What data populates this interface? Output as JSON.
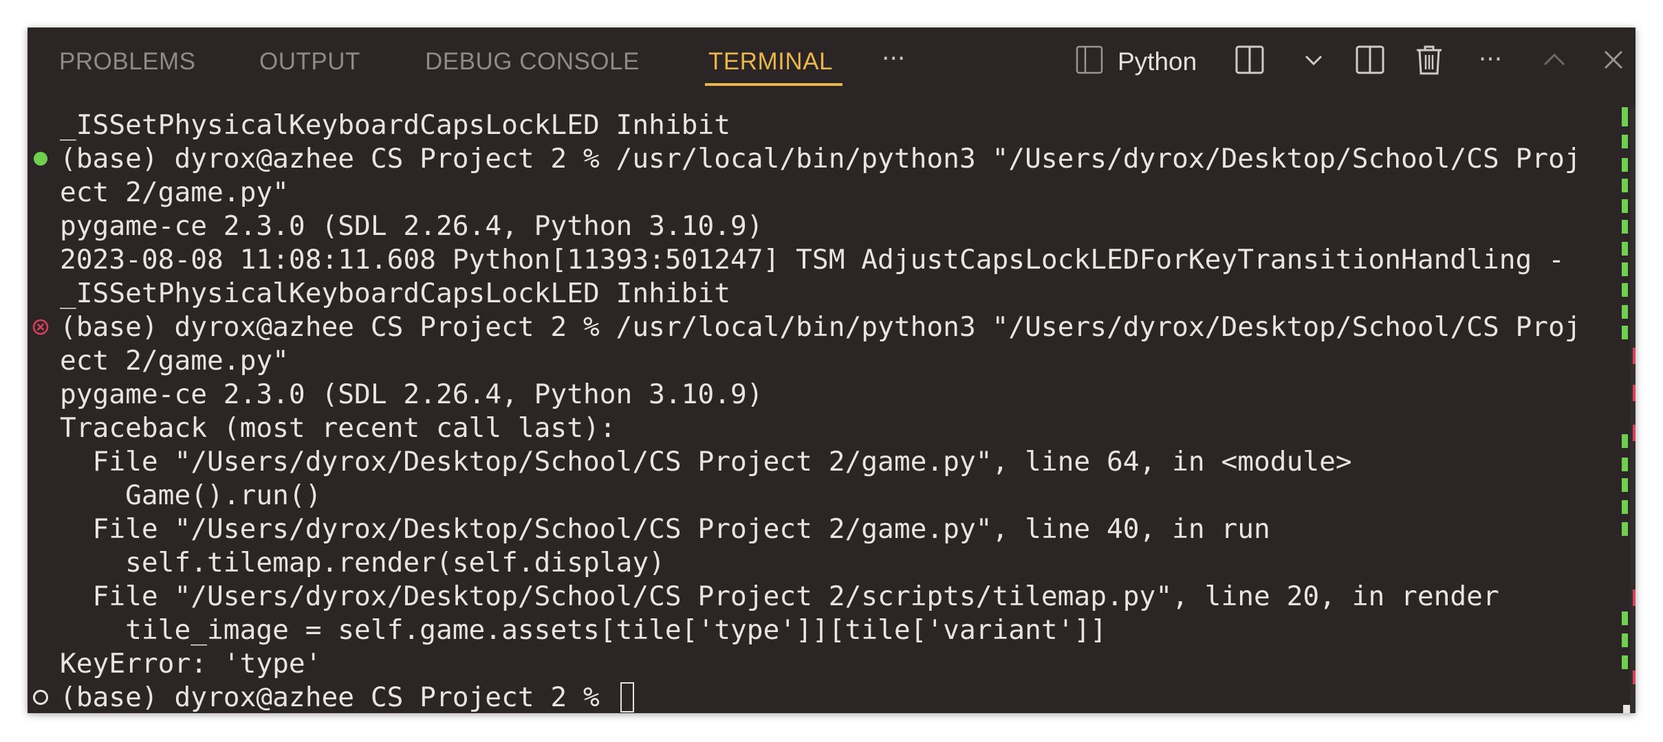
{
  "tabs": {
    "problems": "PROBLEMS",
    "output": "OUTPUT",
    "debug_console": "DEBUG CONSOLE",
    "terminal": "TERMINAL",
    "more": "···"
  },
  "toolbar": {
    "shell_name": "Python",
    "icons": [
      "terminal-shell-icon",
      "split-terminal-icon",
      "chevron-down-icon",
      "split-editor-icon",
      "trash-icon",
      "more-actions-icon",
      "maximize-panel-icon",
      "close-panel-icon"
    ],
    "more_glyph": "···"
  },
  "colors": {
    "panel_bg": "#2b2526",
    "active_tab": "#e8b64a",
    "inactive_tab": "#8f8a8a",
    "text": "#e9e4e4",
    "success": "#6fcf4f",
    "error": "#d9405a"
  },
  "terminal": {
    "lines": [
      {
        "text": "_ISSetPhysicalKeyboardCapsLockLED Inhibit",
        "decoration": "none"
      },
      {
        "text": "(base) dyrox@azhee CS Project 2 % /usr/local/bin/python3 \"/Users/dyrox/Desktop/School/CS Proj",
        "decoration": "success"
      },
      {
        "text": "ect 2/game.py\"",
        "decoration": "none"
      },
      {
        "text": "pygame-ce 2.3.0 (SDL 2.26.4, Python 3.10.9)",
        "decoration": "none"
      },
      {
        "text": "2023-08-08 11:08:11.608 Python[11393:501247] TSM AdjustCapsLockLEDForKeyTransitionHandling -",
        "decoration": "none"
      },
      {
        "text": "_ISSetPhysicalKeyboardCapsLockLED Inhibit",
        "decoration": "none"
      },
      {
        "text": "(base) dyrox@azhee CS Project 2 % /usr/local/bin/python3 \"/Users/dyrox/Desktop/School/CS Proj",
        "decoration": "error"
      },
      {
        "text": "ect 2/game.py\"",
        "decoration": "none"
      },
      {
        "text": "pygame-ce 2.3.0 (SDL 2.26.4, Python 3.10.9)",
        "decoration": "none"
      },
      {
        "text": "Traceback (most recent call last):",
        "decoration": "none"
      },
      {
        "text": "  File \"/Users/dyrox/Desktop/School/CS Project 2/game.py\", line 64, in <module>",
        "decoration": "none"
      },
      {
        "text": "    Game().run()",
        "decoration": "none"
      },
      {
        "text": "  File \"/Users/dyrox/Desktop/School/CS Project 2/game.py\", line 40, in run",
        "decoration": "none"
      },
      {
        "text": "    self.tilemap.render(self.display)",
        "decoration": "none"
      },
      {
        "text": "  File \"/Users/dyrox/Desktop/School/CS Project 2/scripts/tilemap.py\", line 20, in render",
        "decoration": "none"
      },
      {
        "text": "    tile_image = self.game.assets[tile['type']][tile['variant']]",
        "decoration": "none"
      },
      {
        "text": "KeyError: 'type'",
        "decoration": "none"
      },
      {
        "text": "(base) dyrox@azhee CS Project 2 % ",
        "decoration": "pending"
      }
    ]
  }
}
